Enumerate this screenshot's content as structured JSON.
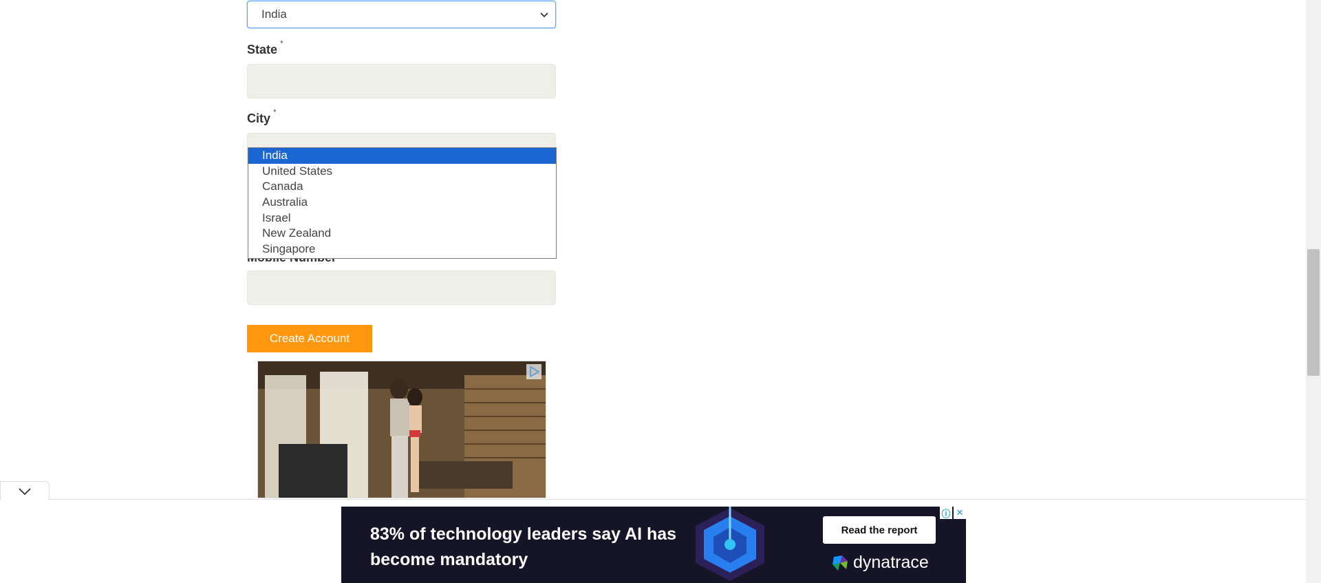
{
  "form": {
    "country_value": "India",
    "state_label": "State",
    "city_label": "City",
    "mobile_label": "Mobile Number",
    "required_marker": "*",
    "create_button": "Create Account"
  },
  "country_dropdown": {
    "options": [
      "India",
      "United States",
      "Canada",
      "Australia",
      "Israel",
      "New Zealand",
      "Singapore"
    ],
    "selected": "India"
  },
  "banner_ad": {
    "headline": "83% of technology leaders say AI has become mandatory",
    "cta": "Read the report",
    "brand": "dynatrace",
    "info_icon": "info-icon",
    "close_icon": "close-icon"
  },
  "colors": {
    "accent": "#ff9710",
    "select_highlight": "#1a66d2",
    "input_bg": "#efefea",
    "banner_bg": "#151527"
  }
}
